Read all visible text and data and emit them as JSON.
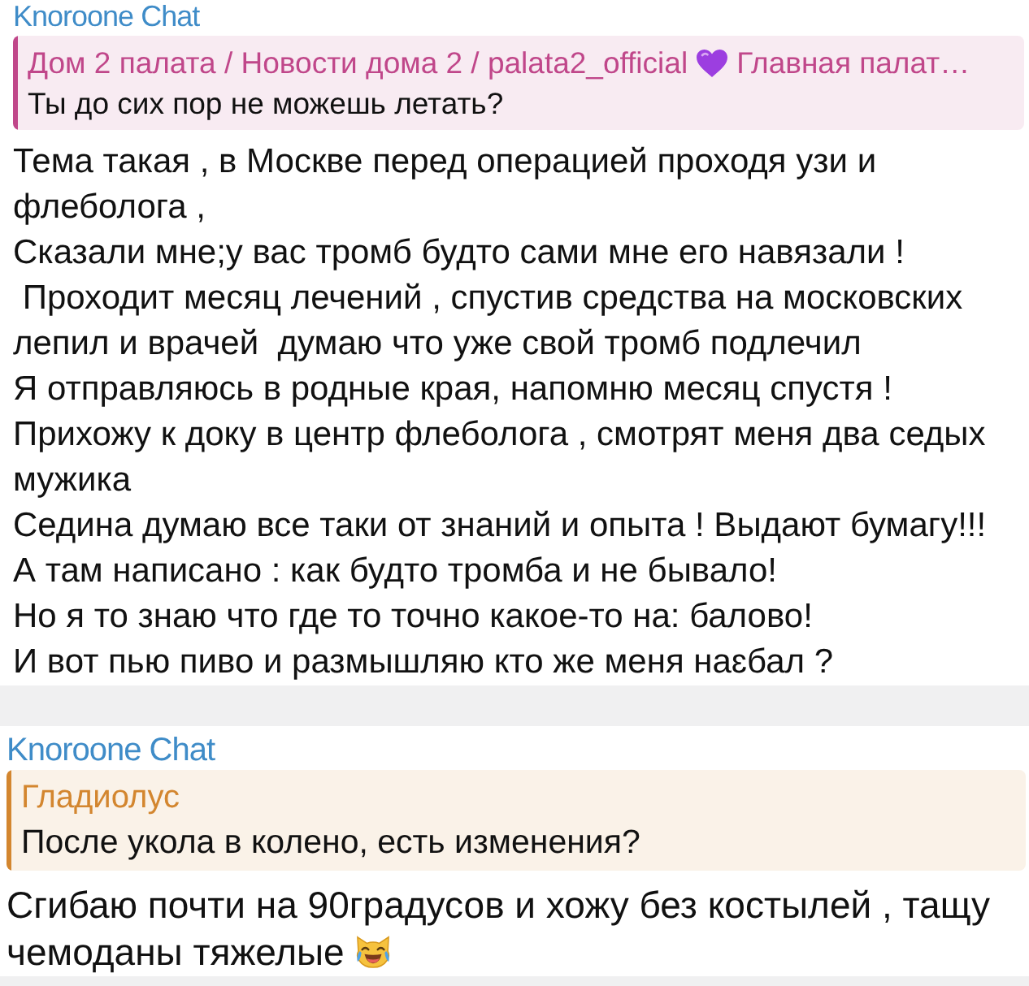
{
  "messages": [
    {
      "sender": "Knoroone Chat",
      "reply": {
        "color": "#c0478a",
        "name_parts": [
          {
            "kind": "text",
            "text": "Дом 2 палата / Новости дома 2 / palata2_official"
          },
          {
            "kind": "emoji"
          },
          {
            "kind": "text",
            "text": "Главная палат…"
          }
        ],
        "text": "Ты до сих пор не можешь летать?"
      },
      "text": "Тема такая , в Москве перед операцией проходя узи и флеболога ,\nСказали мне;у вас тромб будто сами мне его навязали !\n Проходит месяц лечений , спустив средства на московских лепил и врачей  думаю что уже свой тромб подлечил\nЯ отправляюсь в родные края, напомню месяц спустя !\nПрихожу к доку в центр флеболога , смотрят меня два седых мужика\nСедина думаю все таки от знаний и опыта ! Выдают бумагу!!!\nА там написано : как будто тромба и не бывало!\nНо я то знаю что где то точно какое-то на: балово!\nИ вот пью пиво и размышляю кто же меня наɛбал ?"
    },
    {
      "sender": "Knoroone Chat",
      "reply": {
        "color": "#d3862f",
        "name_parts": [
          {
            "kind": "text",
            "text": "Гладиолус"
          }
        ],
        "text": "После укола в колено, есть изменения?"
      },
      "text": "Сгибаю почти на 90градусов и хожу без костылей , тащу чемоданы тяжелые",
      "emoji_after": true
    }
  ]
}
